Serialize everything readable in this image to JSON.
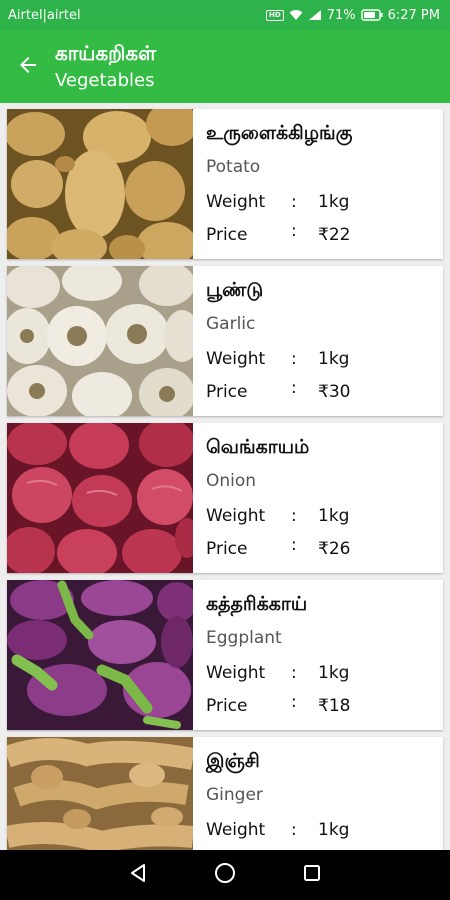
{
  "status_bar": {
    "carrier": "Airtel|airtel",
    "battery": "71%",
    "time": "6:27 PM"
  },
  "header": {
    "title_ta": "காய்கறிகள்",
    "title_en": "Vegetables"
  },
  "labels": {
    "weight": "Weight",
    "price": "Price",
    "colon": ":"
  },
  "items": [
    {
      "name_ta": "உருளைக்கிழங்கு",
      "name_en": "Potato",
      "weight": "1kg",
      "price": "₹22",
      "image": "potato"
    },
    {
      "name_ta": "பூண்டு",
      "name_en": "Garlic",
      "weight": "1kg",
      "price": "₹30",
      "image": "garlic"
    },
    {
      "name_ta": "வெங்காயம்",
      "name_en": "Onion",
      "weight": "1kg",
      "price": "₹26",
      "image": "onion"
    },
    {
      "name_ta": "கத்தரிக்காய்",
      "name_en": "Eggplant",
      "weight": "1kg",
      "price": "₹18",
      "image": "eggplant"
    },
    {
      "name_ta": "இஞ்சி",
      "name_en": "Ginger",
      "weight": "1kg",
      "price": "",
      "image": "ginger"
    }
  ],
  "colors": {
    "status_bar": "#2db34a",
    "app_bar": "#33bb44",
    "nav_bar": "#000000"
  },
  "icons": [
    "back-arrow-icon",
    "back-nav-icon",
    "home-nav-icon",
    "recents-nav-icon"
  ]
}
